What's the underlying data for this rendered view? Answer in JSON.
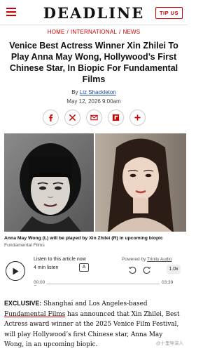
{
  "header": {
    "logo": "DEADLINE",
    "tip_label": "TIP US"
  },
  "breadcrumbs": [
    "HOME",
    "INTERNATIONAL",
    "NEWS"
  ],
  "breadcrumb_sep": "/",
  "headline": "Venice Best Actress Winner Xin Zhilei To Play Anna May Wong, Hollywood’s First Chinese Star, In Biopic For Fundamental Films",
  "byline": {
    "prefix": "By",
    "author": "Liz Shackleton"
  },
  "date": "May 12, 2026 9:00am",
  "share_icons": [
    "facebook-icon",
    "x-icon",
    "email-icon",
    "flipboard-icon",
    "more-plus-icon"
  ],
  "caption": "Anna May Wong (L) will be played by Xin Zhilei (R) in upcoming biopic",
  "credit": "Fundamental Films",
  "player": {
    "listen_label": "Listen to this article now",
    "duration_label": "4 min listen",
    "powered_prefix": "Powered by",
    "powered_brand": "Trinity Audio",
    "speed": "1.0x",
    "time_start": "00:00",
    "time_end": "03:39",
    "progress": 0
  },
  "body": {
    "lead": "EXCLUSIVE:",
    "part1": " Shanghai and Los Angeles-based ",
    "link": "Fundamental Films",
    "part2": " has announced that Xin Zhilei, Best Actress award winner at the 2025 Venice Film Festival, will play Hollywood’s first Chinese star, Anna May Wong, in an upcoming biopic."
  },
  "watermark": "@十里导演人",
  "colors": {
    "brand_red": "#cc0000",
    "link_blue": "#1a4fa0"
  }
}
